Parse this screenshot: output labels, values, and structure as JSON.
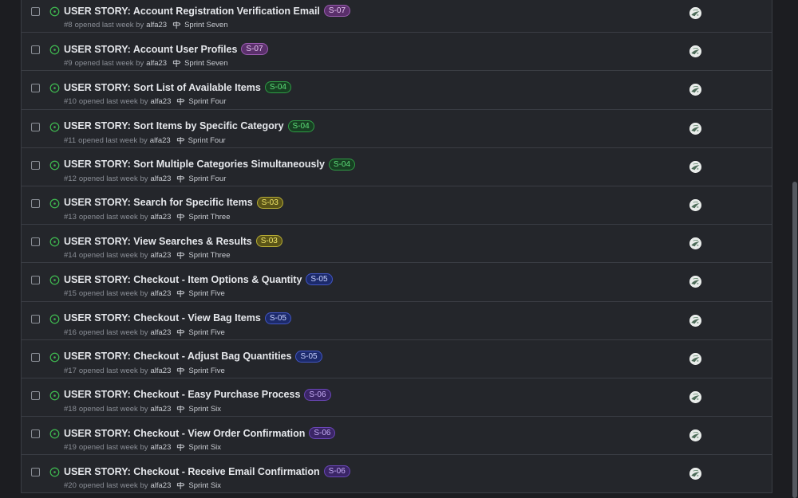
{
  "issues": [
    {
      "title": "USER STORY: Account Registration Verification Email",
      "label": "S-07",
      "label_color": "purple",
      "number": "#8",
      "opened": "opened last week by",
      "author": "alfa23",
      "milestone": "Sprint Seven"
    },
    {
      "title": "USER STORY: Account User Profiles",
      "label": "S-07",
      "label_color": "purple",
      "number": "#9",
      "opened": "opened last week by",
      "author": "alfa23",
      "milestone": "Sprint Seven"
    },
    {
      "title": "USER STORY: Sort List of Available Items",
      "label": "S-04",
      "label_color": "green",
      "number": "#10",
      "opened": "opened last week by",
      "author": "alfa23",
      "milestone": "Sprint Four"
    },
    {
      "title": "USER STORY: Sort Items by Specific Category",
      "label": "S-04",
      "label_color": "green",
      "number": "#11",
      "opened": "opened last week by",
      "author": "alfa23",
      "milestone": "Sprint Four"
    },
    {
      "title": "USER STORY: Sort Multiple Categories Simultaneously",
      "label": "S-04",
      "label_color": "green",
      "number": "#12",
      "opened": "opened last week by",
      "author": "alfa23",
      "milestone": "Sprint Four"
    },
    {
      "title": "USER STORY: Search for Specific Items",
      "label": "S-03",
      "label_color": "yellow",
      "number": "#13",
      "opened": "opened last week by",
      "author": "alfa23",
      "milestone": "Sprint Three"
    },
    {
      "title": "USER STORY: View Searches & Results",
      "label": "S-03",
      "label_color": "yellow",
      "number": "#14",
      "opened": "opened last week by",
      "author": "alfa23",
      "milestone": "Sprint Three"
    },
    {
      "title": "USER STORY: Checkout - Item Options & Quantity",
      "label": "S-05",
      "label_color": "blue",
      "number": "#15",
      "opened": "opened last week by",
      "author": "alfa23",
      "milestone": "Sprint Five"
    },
    {
      "title": "USER STORY: Checkout - View Bag Items",
      "label": "S-05",
      "label_color": "blue",
      "number": "#16",
      "opened": "opened last week by",
      "author": "alfa23",
      "milestone": "Sprint Five"
    },
    {
      "title": "USER STORY: Checkout - Adjust Bag Quantities",
      "label": "S-05",
      "label_color": "blue",
      "number": "#17",
      "opened": "opened last week by",
      "author": "alfa23",
      "milestone": "Sprint Five"
    },
    {
      "title": "USER STORY: Checkout - Easy Purchase Process",
      "label": "S-06",
      "label_color": "violet",
      "number": "#18",
      "opened": "opened last week by",
      "author": "alfa23",
      "milestone": "Sprint Six"
    },
    {
      "title": "USER STORY: Checkout - View Order Confirmation",
      "label": "S-06",
      "label_color": "violet",
      "number": "#19",
      "opened": "opened last week by",
      "author": "alfa23",
      "milestone": "Sprint Six"
    },
    {
      "title": "USER STORY: Checkout - Receive Email Confirmation",
      "label": "S-06",
      "label_color": "violet",
      "number": "#20",
      "opened": "opened last week by",
      "author": "alfa23",
      "milestone": "Sprint Six"
    }
  ],
  "label_styles": {
    "purple": {
      "bg": "#5a2f6b",
      "border": "#9a5bb0",
      "fg": "#e7c7f2"
    },
    "green": {
      "bg": "#173f22",
      "border": "#2f9c45",
      "fg": "#5ee07a"
    },
    "yellow": {
      "bg": "#5a5418",
      "border": "#b8ad34",
      "fg": "#f2e86a"
    },
    "blue": {
      "bg": "#1c2a6b",
      "border": "#4256c4",
      "fg": "#c9d2ff"
    },
    "violet": {
      "bg": "#3a2566",
      "border": "#6a46b8",
      "fg": "#c7aef7"
    }
  },
  "status_icon": "issue-opened-icon",
  "status_color": "#3fb950",
  "milestone_icon": "milestone-icon",
  "avatar_icon": "avatar-icon"
}
